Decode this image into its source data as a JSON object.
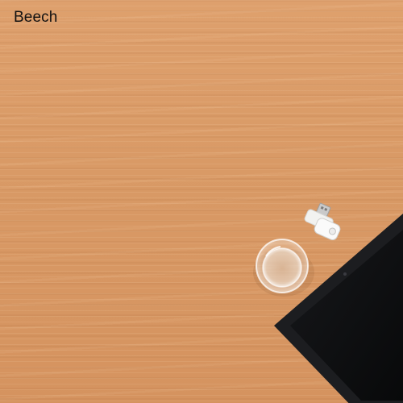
{
  "sample_label": "Beech",
  "colors": {
    "wood": "#d99a66",
    "tablet_frame": "#1c1d20",
    "tablet_screen": "#0e0f11",
    "usb_body": "#f2f2f0",
    "usb_connector": "#c9c9c9",
    "label_text": "#111111"
  },
  "objects": [
    "glass-of-water",
    "usb-flash-drive",
    "tablet"
  ]
}
